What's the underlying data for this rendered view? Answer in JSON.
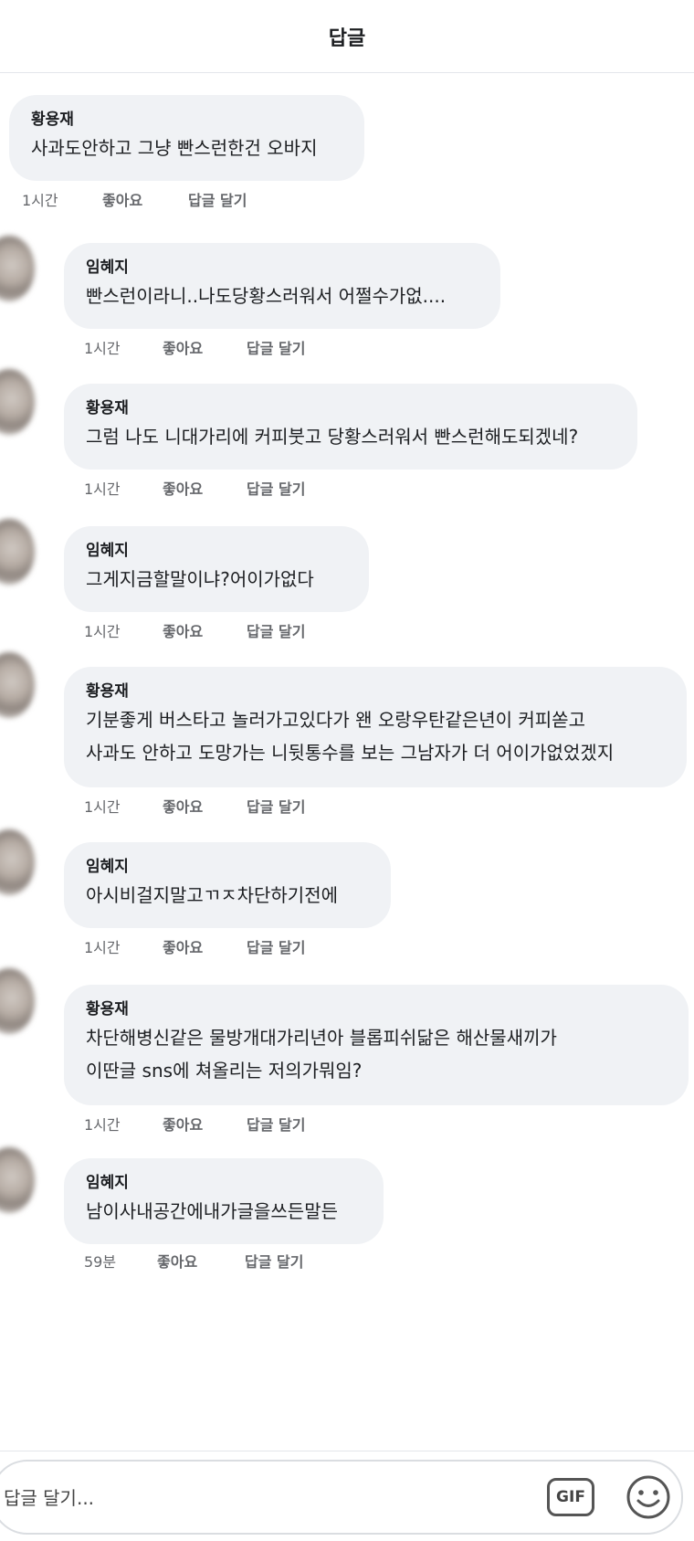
{
  "header": {
    "title": "답글"
  },
  "comments": [
    {
      "author": "황용재",
      "lines": [
        "사과도안하고 그냥 빤스런한건 오바지"
      ],
      "time": "1시간",
      "like": "좋아요",
      "reply": "답글 달기"
    },
    {
      "author": "임혜지",
      "lines": [
        "빤스런이라니..나도당황스러워서 어쩔수가없...."
      ],
      "time": "1시간",
      "like": "좋아요",
      "reply": "답글 달기"
    },
    {
      "author": "황용재",
      "lines": [
        "그럼 나도 니대가리에 커피붓고 당황스러워서 빤스런해도되겠네?"
      ],
      "time": "1시간",
      "like": "좋아요",
      "reply": "답글 달기"
    },
    {
      "author": "임혜지",
      "lines": [
        "그게지금할말이냐?어이가없다"
      ],
      "time": "1시간",
      "like": "좋아요",
      "reply": "답글 달기"
    },
    {
      "author": "황용재",
      "lines": [
        "기분좋게 버스타고 놀러가고있다가 왠 오랑우탄같은년이 커피쏟고",
        "사과도 안하고 도망가는 니뒷통수를 보는 그남자가 더 어이가없었겠지"
      ],
      "time": "1시간",
      "like": "좋아요",
      "reply": "답글 달기"
    },
    {
      "author": "임혜지",
      "lines": [
        "아시비걸지말고ㄲㅈ차단하기전에"
      ],
      "time": "1시간",
      "like": "좋아요",
      "reply": "답글 달기"
    },
    {
      "author": "황용재",
      "lines": [
        "차단해병신같은 물방개대가리년아 블롭피쉬닮은 해산물새끼가",
        "이딴글 sns에 쳐올리는 저의가뭐임?"
      ],
      "time": "1시간",
      "like": "좋아요",
      "reply": "답글 달기"
    },
    {
      "author": "임혜지",
      "lines": [
        "남이사내공간에내가글을쓰든말든"
      ],
      "time": "59분",
      "like": "좋아요",
      "reply": "답글 달기"
    }
  ],
  "composer": {
    "placeholder": "답글 달기...",
    "gif_label": "GIF",
    "emoji_icon": "smiley-icon"
  },
  "colors": {
    "bubble": "#f0f2f5",
    "meta_text": "#65676b",
    "divider": "#e4e6eb"
  }
}
